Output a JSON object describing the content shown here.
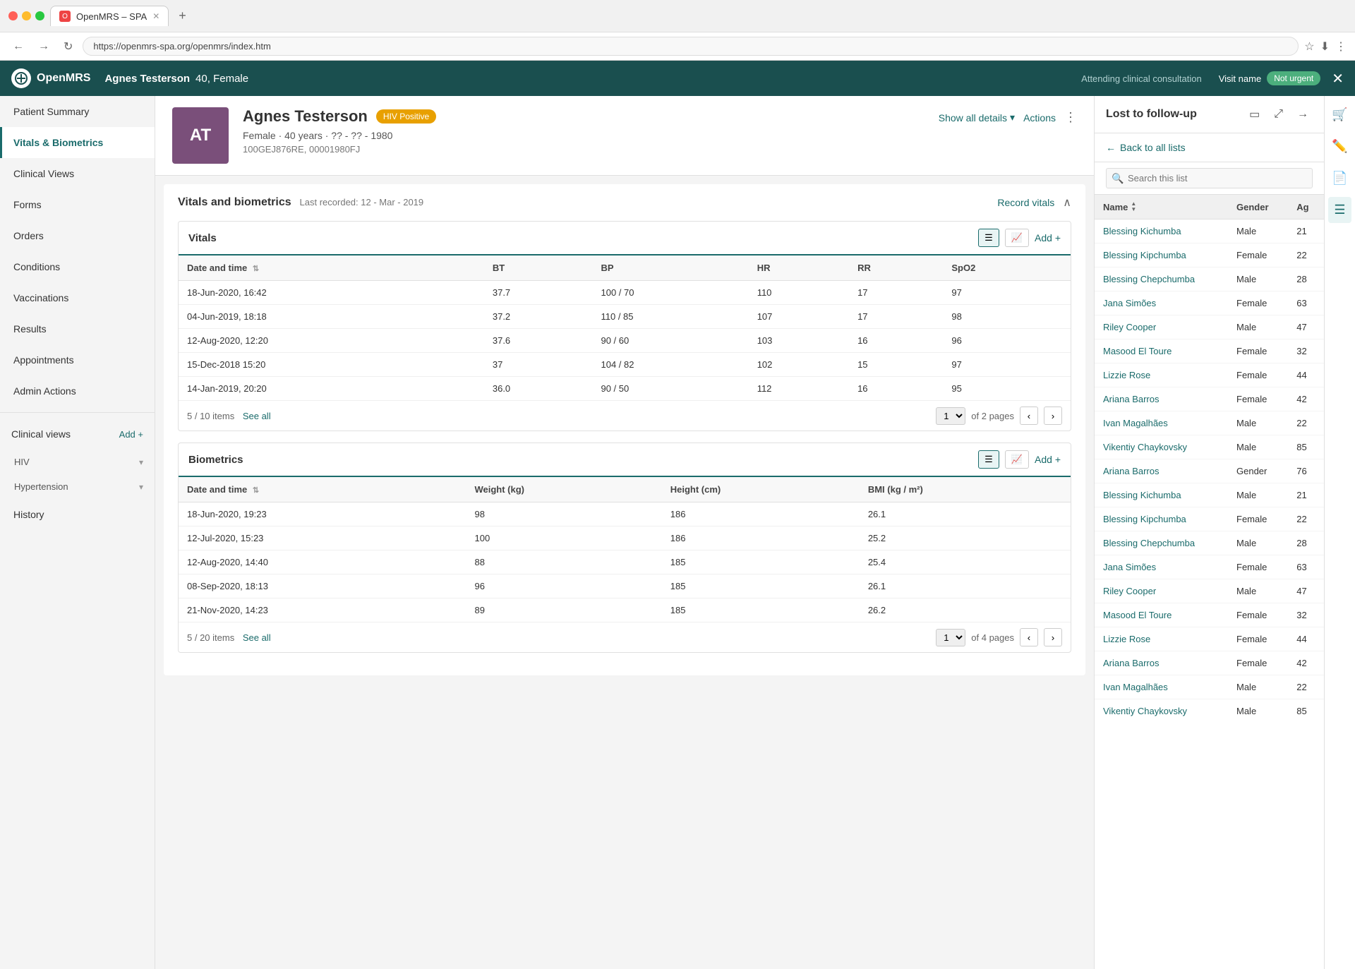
{
  "browser": {
    "url": "https://openmrs-spa.org/openmrs/index.htm",
    "tab_title": "OpenMRS – SPA",
    "tab_icon": "O"
  },
  "app_header": {
    "logo": "OpenMRS",
    "patient_name": "Agnes Testerson",
    "patient_age_gender": "40, Female",
    "visit_type": "Attending clinical consultation",
    "visit_name_label": "Visit name",
    "urgency_badge": "Not urgent"
  },
  "sidebar": {
    "items": [
      {
        "id": "patient-summary",
        "label": "Patient Summary",
        "active": false
      },
      {
        "id": "vitals-biometrics",
        "label": "Vitals & Biometrics",
        "active": true
      },
      {
        "id": "clinical-views",
        "label": "Clinical Views",
        "active": false
      },
      {
        "id": "forms",
        "label": "Forms",
        "active": false
      },
      {
        "id": "orders",
        "label": "Orders",
        "active": false
      },
      {
        "id": "conditions",
        "label": "Conditions",
        "active": false
      },
      {
        "id": "vaccinations",
        "label": "Vaccinations",
        "active": false
      },
      {
        "id": "results",
        "label": "Results",
        "active": false
      },
      {
        "id": "appointments",
        "label": "Appointments",
        "active": false
      },
      {
        "id": "admin-actions",
        "label": "Admin Actions",
        "active": false
      }
    ],
    "clinical_views_section": {
      "title": "Clinical views",
      "add_label": "Add +",
      "items": [
        {
          "label": "HIV",
          "expanded": false
        },
        {
          "label": "Hypertension",
          "expanded": false
        }
      ]
    },
    "history_label": "History"
  },
  "patient": {
    "initials": "AT",
    "name": "Agnes Testerson",
    "hiv_status": "HIV Positive",
    "gender": "Female",
    "age": "40 years",
    "dob": "?? - ?? - 1980",
    "id1": "100GEJ876RE",
    "id2": "00001980FJ",
    "actions_label": "Actions",
    "show_all_details": "Show all details"
  },
  "vitals_section": {
    "title": "Vitals and biometrics",
    "last_recorded": "Last recorded: 12 - Mar - 2019",
    "record_vitals_label": "Record vitals",
    "vitals_sub": {
      "title": "Vitals",
      "add_label": "Add +",
      "columns": [
        "Date and time",
        "BT",
        "BP",
        "HR",
        "RR",
        "SpO2"
      ],
      "rows": [
        {
          "date": "18-Jun-2020, 16:42",
          "bt": "37.7",
          "bp": "100 / 70",
          "hr": "110",
          "rr": "17",
          "spo2": "97"
        },
        {
          "date": "04-Jun-2019, 18:18",
          "bt": "37.2",
          "bp": "110 / 85",
          "hr": "107",
          "rr": "17",
          "spo2": "98"
        },
        {
          "date": "12-Aug-2020, 12:20",
          "bt": "37.6",
          "bp": "90 / 60",
          "hr": "103",
          "rr": "16",
          "spo2": "96"
        },
        {
          "date": "15-Dec-2018 15:20",
          "bt": "37",
          "bp": "104 / 82",
          "hr": "102",
          "rr": "15",
          "spo2": "97"
        },
        {
          "date": "14-Jan-2019, 20:20",
          "bt": "36.0",
          "bp": "90 / 50",
          "hr": "112",
          "rr": "16",
          "spo2": "95"
        }
      ],
      "items_count": "5 / 10 items",
      "see_all_label": "See all",
      "page_info": "1",
      "of_pages": "of 2 pages"
    },
    "biometrics_sub": {
      "title": "Biometrics",
      "add_label": "Add +",
      "columns": [
        "Date and time",
        "Weight (kg)",
        "Height (cm)",
        "BMI (kg / m²)"
      ],
      "rows": [
        {
          "date": "18-Jun-2020, 19:23",
          "weight": "98",
          "height": "186",
          "bmi": "26.1"
        },
        {
          "date": "12-Jul-2020, 15:23",
          "weight": "100",
          "height": "186",
          "bmi": "25.2"
        },
        {
          "date": "12-Aug-2020, 14:40",
          "weight": "88",
          "height": "185",
          "bmi": "25.4"
        },
        {
          "date": "08-Sep-2020, 18:13",
          "weight": "96",
          "height": "185",
          "bmi": "26.1"
        },
        {
          "date": "21-Nov-2020, 14:23",
          "weight": "89",
          "height": "185",
          "bmi": "26.2"
        }
      ],
      "items_count": "5 / 20 items",
      "see_all_label": "See all",
      "page_info": "1",
      "of_pages": "of 4 pages"
    }
  },
  "right_panel": {
    "title": "Lost to follow-up",
    "back_label": "Back to all lists",
    "search_placeholder": "Search this list",
    "columns": [
      "Name",
      "Gender",
      "Ag"
    ],
    "patients": [
      {
        "name": "Blessing Kichumba",
        "gender": "Male",
        "age": "21"
      },
      {
        "name": "Blessing Kipchumba",
        "gender": "Female",
        "age": "22"
      },
      {
        "name": "Blessing Chepchumba",
        "gender": "Male",
        "age": "28"
      },
      {
        "name": "Jana Simões",
        "gender": "Female",
        "age": "63"
      },
      {
        "name": "Riley Cooper",
        "gender": "Male",
        "age": "47"
      },
      {
        "name": "Masood El Toure",
        "gender": "Female",
        "age": "32"
      },
      {
        "name": "Lizzie Rose",
        "gender": "Female",
        "age": "44"
      },
      {
        "name": "Ariana Barros",
        "gender": "Female",
        "age": "42"
      },
      {
        "name": "Ivan Magalhães",
        "gender": "Male",
        "age": "22"
      },
      {
        "name": "Vikentiy Chaykovsky",
        "gender": "Male",
        "age": "85"
      },
      {
        "name": "Ariana Barros",
        "gender": "Gender",
        "age": "76"
      },
      {
        "name": "Blessing Kichumba",
        "gender": "Male",
        "age": "21"
      },
      {
        "name": "Blessing Kipchumba",
        "gender": "Female",
        "age": "22"
      },
      {
        "name": "Blessing Chepchumba",
        "gender": "Male",
        "age": "28"
      },
      {
        "name": "Jana Simões",
        "gender": "Female",
        "age": "63"
      },
      {
        "name": "Riley Cooper",
        "gender": "Male",
        "age": "47"
      },
      {
        "name": "Masood El Toure",
        "gender": "Female",
        "age": "32"
      },
      {
        "name": "Lizzie Rose",
        "gender": "Female",
        "age": "44"
      },
      {
        "name": "Ariana Barros",
        "gender": "Female",
        "age": "42"
      },
      {
        "name": "Ivan Magalhães",
        "gender": "Male",
        "age": "22"
      },
      {
        "name": "Vikentiy Chaykovsky",
        "gender": "Male",
        "age": "85"
      }
    ]
  }
}
